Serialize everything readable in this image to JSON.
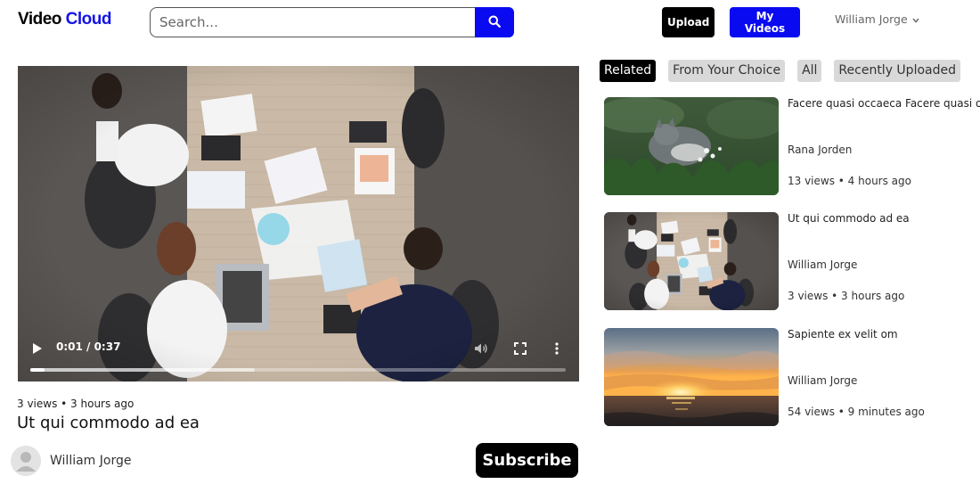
{
  "header": {
    "logo_part1": "Video",
    "logo_part2": "Cloud",
    "search_placeholder": "Search...",
    "upload_label": "Upload",
    "my_videos_label": "My Videos",
    "user_name": "William Jorge"
  },
  "player": {
    "time": "0:01 / 0:37",
    "progress": 0.027,
    "buffered": 0.42
  },
  "video": {
    "meta": "3 views • 3 hours ago",
    "title": "Ut qui commodo ad ea",
    "channel": "William Jorge",
    "subscribe_label": "Subscribe"
  },
  "tabs": [
    {
      "label": "Related",
      "active": true
    },
    {
      "label": "From Your Choice",
      "active": false
    },
    {
      "label": "All",
      "active": false
    },
    {
      "label": "Recently Uploaded",
      "active": false
    }
  ],
  "related": [
    {
      "title": "Facere quasi occaeca Facere quasi oc",
      "author": "Rana Jorden",
      "stats": "13 views • 4 hours ago",
      "thumb": "cat-in-grass"
    },
    {
      "title": "Ut qui commodo ad ea",
      "author": "William Jorge",
      "stats": "3 views • 3 hours ago",
      "thumb": "office-meeting"
    },
    {
      "title": "Sapiente ex velit om",
      "author": "William Jorge",
      "stats": "54 views • 9 minutes ago",
      "thumb": "sunset-sea"
    }
  ],
  "colors": {
    "brand_blue": "#0a0af0",
    "black": "#000000",
    "tab_gray": "#d9d9d9"
  }
}
